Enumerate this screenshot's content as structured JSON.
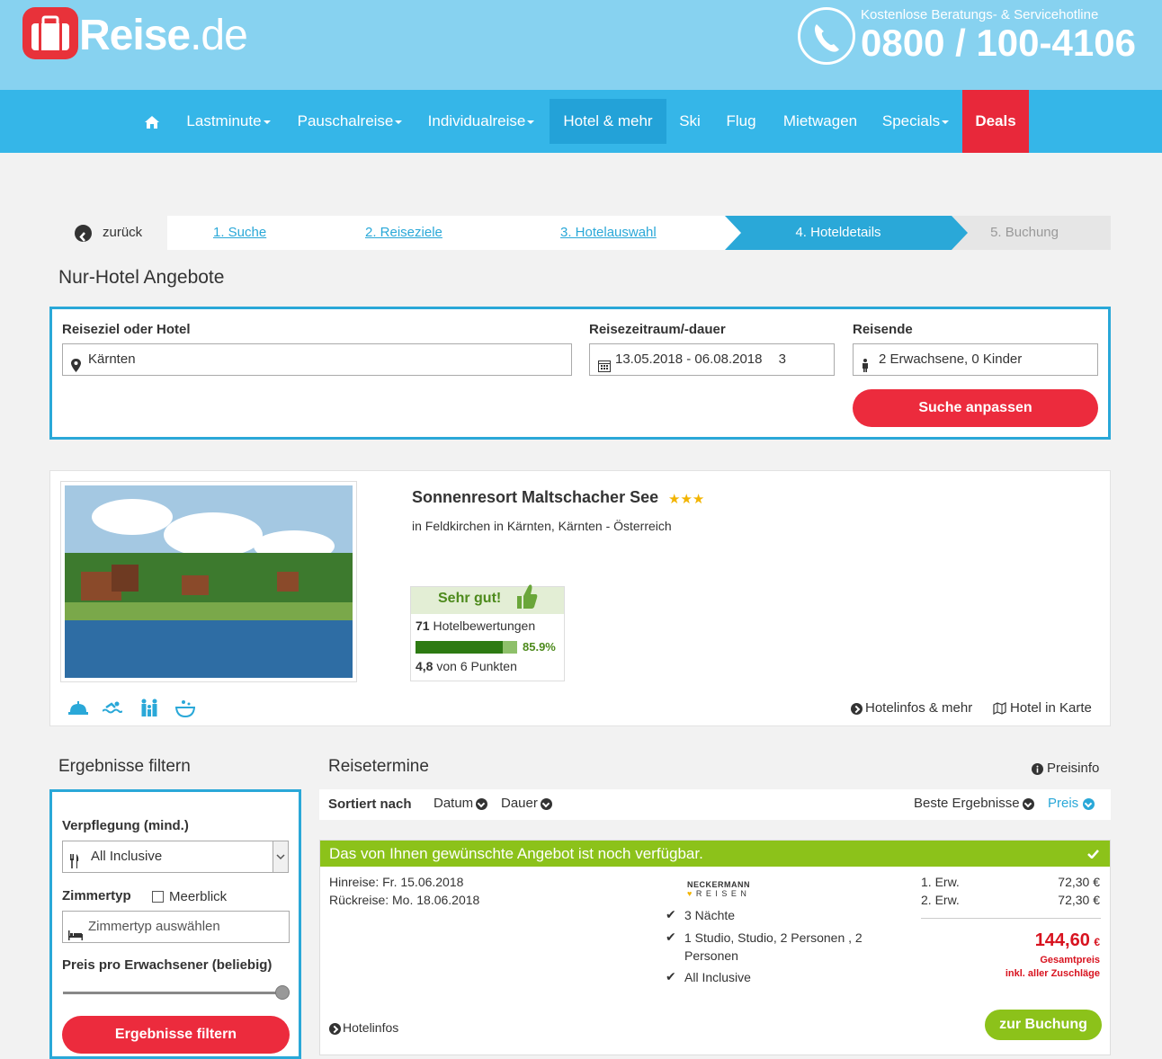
{
  "header": {
    "logo_main": "Reise",
    "logo_suffix": ".de",
    "hotline_label": "Kostenlose Beratungs- & Servicehotline",
    "hotline_number": "0800 / 100-4106"
  },
  "nav": {
    "items": [
      "Lastminute",
      "Pauschalreise",
      "Individualreise",
      "Hotel & mehr",
      "Ski",
      "Flug",
      "Mietwagen",
      "Specials",
      "Deals"
    ]
  },
  "steps": {
    "back": "zurück",
    "s1": "1. Suche",
    "s2": "2. Reiseziele",
    "s3": "3. Hotelauswahl",
    "s4": "4. Hoteldetails",
    "s5": "5. Buchung"
  },
  "search": {
    "title": "Nur-Hotel Angebote",
    "dest_label": "Reiseziel oder Hotel",
    "dest_value": "Kärnten",
    "period_label": "Reisezeitraum/-dauer",
    "period_value": "13.05.2018 - 06.08.2018",
    "period_duration": "3",
    "travelers_label": "Reisende",
    "travelers_value": "2 Erwachsene, 0 Kinder",
    "submit": "Suche anpassen"
  },
  "hotel": {
    "name": "Sonnenresort Maltschacher See",
    "stars": "★★★",
    "location": "in Feldkirchen in Kärnten, Kärnten - Österreich",
    "rating_label": "Sehr gut!",
    "reviews_count": "71",
    "reviews_label": "Hotelbewertungen",
    "recommend_pct": "85.9%",
    "recommend_value": 0.859,
    "score": "4,8",
    "score_suffix": "von 6 Punkten",
    "link_info": "Hotelinfos & mehr",
    "link_map": "Hotel in Karte"
  },
  "filter": {
    "title": "Ergebnisse filtern",
    "board_label": "Verpflegung (mind.)",
    "board_value": "All Inclusive",
    "room_label": "Zimmertyp",
    "seaview_label": "Meerblick",
    "room_placeholder": "Zimmertyp auswählen",
    "price_label": "Preis pro Erwachsener (beliebig)",
    "submit": "Ergebnisse filtern"
  },
  "results": {
    "title": "Reisetermine",
    "priceinfo": "Preisinfo",
    "sorted_by": "Sortiert nach",
    "sort_date": "Datum",
    "sort_duration": "Dauer",
    "sort_best": "Beste Ergebnisse",
    "sort_price": "Preis"
  },
  "offer": {
    "banner": "Das von Ihnen gewünschte Angebot ist noch verfügbar.",
    "outbound": "Hinreise: Fr. 15.06.2018",
    "return": "Rückreise: Mo. 18.06.2018",
    "operator_line1": "NECKERMANN",
    "operator_line2": "R E I S E N",
    "feature1": "3 Nächte",
    "feature2a": "1 Studio, Studio, 2 Personen , 2",
    "feature2b": "Personen",
    "feature3": "All Inclusive",
    "pax1_label": "1. Erw.",
    "pax1_price": "72,30 €",
    "pax2_label": "2. Erw.",
    "pax2_price": "72,30 €",
    "total": "144,60",
    "currency": "€",
    "total_label": "Gesamtpreis",
    "total_sub": "inkl. aller Zuschläge",
    "hotelinfos": "Hotelinfos",
    "book": "zur Buchung"
  },
  "colors": {
    "brand_blue": "#35b6e8",
    "brand_red": "#ec2b3d",
    "accent_green": "#8cc21a"
  }
}
